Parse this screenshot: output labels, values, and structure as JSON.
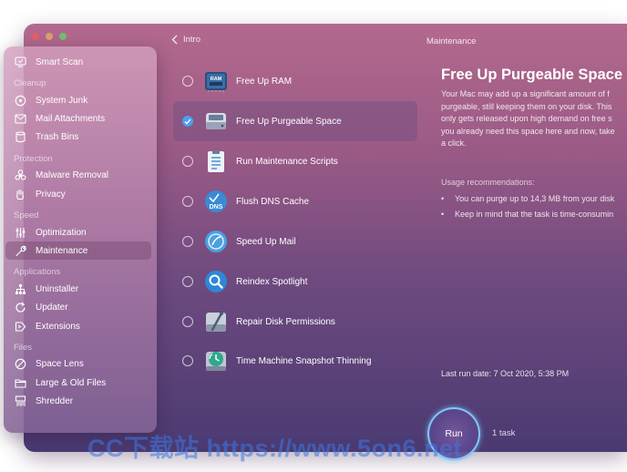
{
  "window": {
    "back_label": "Intro",
    "section_title": "Maintenance"
  },
  "sidebar": {
    "top_item": {
      "label": "Smart Scan",
      "icon": "monitor-icon"
    },
    "groups": [
      {
        "heading": "Cleanup",
        "items": [
          {
            "label": "System Junk",
            "icon": "disk-icon"
          },
          {
            "label": "Mail Attachments",
            "icon": "envelope-icon"
          },
          {
            "label": "Trash Bins",
            "icon": "trash-icon"
          }
        ]
      },
      {
        "heading": "Protection",
        "items": [
          {
            "label": "Malware Removal",
            "icon": "biohazard-icon"
          },
          {
            "label": "Privacy",
            "icon": "hand-icon"
          }
        ]
      },
      {
        "heading": "Speed",
        "items": [
          {
            "label": "Optimization",
            "icon": "sliders-icon"
          },
          {
            "label": "Maintenance",
            "icon": "wrench-icon",
            "active": true
          }
        ]
      },
      {
        "heading": "Applications",
        "items": [
          {
            "label": "Uninstaller",
            "icon": "network-icon"
          },
          {
            "label": "Updater",
            "icon": "refresh-icon"
          },
          {
            "label": "Extensions",
            "icon": "extensions-icon"
          }
        ]
      },
      {
        "heading": "Files",
        "items": [
          {
            "label": "Space Lens",
            "icon": "lens-icon"
          },
          {
            "label": "Large & Old Files",
            "icon": "folder-icon"
          },
          {
            "label": "Shredder",
            "icon": "shredder-icon"
          }
        ]
      }
    ]
  },
  "tasks": [
    {
      "label": "Free Up RAM",
      "icon": "ram-chip-icon",
      "icon_text": "RAM",
      "checked": false
    },
    {
      "label": "Free Up Purgeable Space",
      "icon": "hard-drive-icon",
      "checked": true
    },
    {
      "label": "Run Maintenance Scripts",
      "icon": "clipboard-icon",
      "checked": false
    },
    {
      "label": "Flush DNS Cache",
      "icon": "dns-icon",
      "icon_text": "DNS",
      "checked": false
    },
    {
      "label": "Speed Up Mail",
      "icon": "mail-stamp-icon",
      "checked": false
    },
    {
      "label": "Reindex Spotlight",
      "icon": "spotlight-icon",
      "checked": false
    },
    {
      "label": "Repair Disk Permissions",
      "icon": "disk-permissions-icon",
      "checked": false
    },
    {
      "label": "Time Machine Snapshot Thinning",
      "icon": "time-machine-icon",
      "checked": false
    }
  ],
  "detail": {
    "title": "Free Up Purgeable Space",
    "paragraph_lines": [
      "Your Mac may add up a significant amount of f",
      "purgeable, still keeping them on your disk. This",
      "only gets released upon high demand on free s",
      "you already need this space here and now, take",
      "a click."
    ],
    "usage_heading": "Usage recommendations:",
    "usage_items": [
      "You can purge up to 14,3 MB from your disk",
      "Keep in mind that the task is time-consumin"
    ],
    "last_run": "Last run date: 7 Oct 2020, 5:38 PM"
  },
  "run": {
    "button_label": "Run",
    "task_count": "1 task"
  },
  "watermark": "CC下载站 https://www.5on6.net",
  "colors": {
    "accent_check": "#4aa0f0",
    "run_glow": "#8cd2ff"
  }
}
